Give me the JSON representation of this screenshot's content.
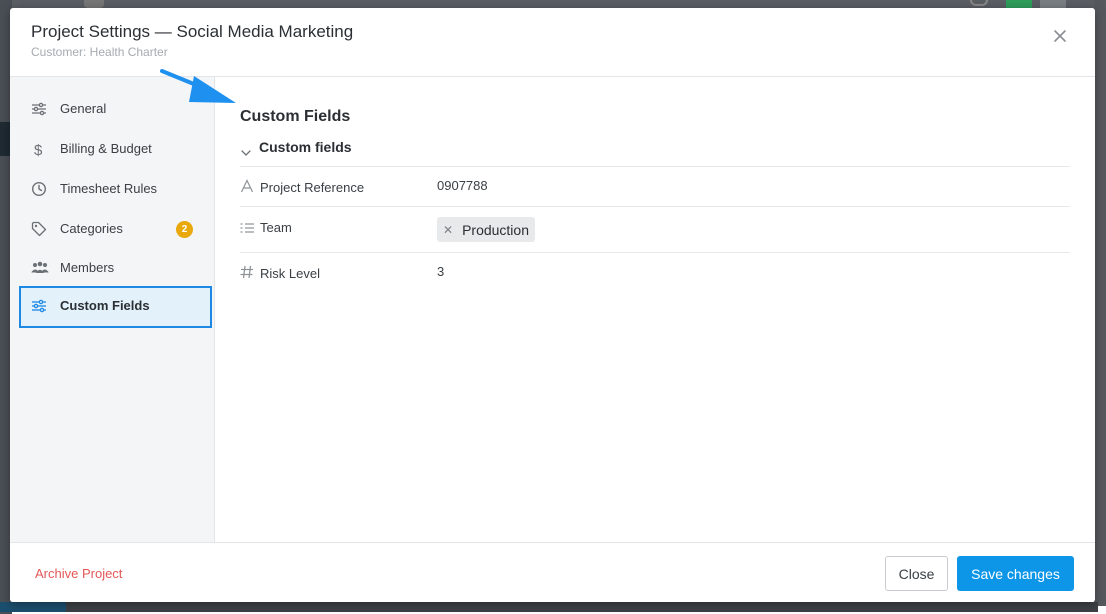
{
  "modal": {
    "title": "Project Settings — Social Media Marketing",
    "subtitle": "Customer: Health Charter"
  },
  "sidebar": {
    "items": [
      {
        "label": "General",
        "icon": "sliders-icon"
      },
      {
        "label": "Billing & Budget",
        "icon": "dollar-icon"
      },
      {
        "label": "Timesheet Rules",
        "icon": "clock-icon"
      },
      {
        "label": "Categories",
        "icon": "tag-icon",
        "badge": "2"
      },
      {
        "label": "Members",
        "icon": "users-icon"
      },
      {
        "label": "Custom Fields",
        "icon": "sliders-icon",
        "active": true
      }
    ]
  },
  "content": {
    "section_title": "Custom Fields",
    "group_label": "Custom fields",
    "fields": [
      {
        "label": "Project Reference",
        "value": "0907788",
        "icon": "text-type-icon"
      },
      {
        "label": "Team",
        "tag": "Production",
        "icon": "list-icon"
      },
      {
        "label": "Risk Level",
        "value": "3",
        "icon": "hash-icon"
      }
    ]
  },
  "footer": {
    "archive_label": "Archive Project",
    "close_label": "Close",
    "save_label": "Save changes"
  },
  "colors": {
    "accent": "#1e88e5",
    "save_button": "#0d96e8",
    "badge": "#e9a90c",
    "danger": "#e45757",
    "arrow": "#1e90f0"
  }
}
